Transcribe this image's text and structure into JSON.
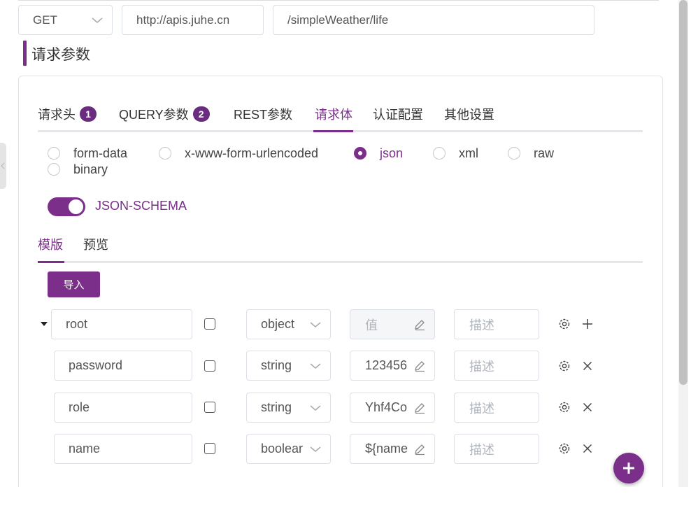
{
  "request": {
    "method": "GET",
    "host": "http://apis.juhe.cn",
    "path": "/simpleWeather/life"
  },
  "section_title": "请求参数",
  "tabs": [
    {
      "label": "请求头",
      "badge": "1"
    },
    {
      "label": "QUERY参数",
      "badge": "2"
    },
    {
      "label": "REST参数"
    },
    {
      "label": "请求体",
      "active": true
    },
    {
      "label": "认证配置"
    },
    {
      "label": "其他设置"
    }
  ],
  "body_types": [
    {
      "label": "form-data",
      "selected": false
    },
    {
      "label": "x-www-form-urlencoded",
      "selected": false
    },
    {
      "label": "json",
      "selected": true
    },
    {
      "label": "xml",
      "selected": false
    },
    {
      "label": "raw",
      "selected": false
    },
    {
      "label": "binary",
      "selected": false
    }
  ],
  "schema_toggle": {
    "label": "JSON-SCHEMA",
    "on": true
  },
  "subtabs": [
    {
      "label": "模版",
      "active": true
    },
    {
      "label": "预览"
    }
  ],
  "import_label": "导入",
  "rows": [
    {
      "name": "root",
      "type": "object",
      "value": "",
      "value_placeholder": "值",
      "desc_placeholder": "描述",
      "action": "add"
    },
    {
      "name": "password",
      "type": "string",
      "value": "123456",
      "desc_placeholder": "描述",
      "action": "remove"
    },
    {
      "name": "role",
      "type": "string",
      "value": "Yhf4Co",
      "desc_placeholder": "描述",
      "action": "remove"
    },
    {
      "name": "name",
      "type": "boolear",
      "value": "${name",
      "desc_placeholder": "描述",
      "action": "remove"
    }
  ],
  "colors": {
    "accent": "#7b2f8a",
    "badge": "#6a2c7e"
  }
}
